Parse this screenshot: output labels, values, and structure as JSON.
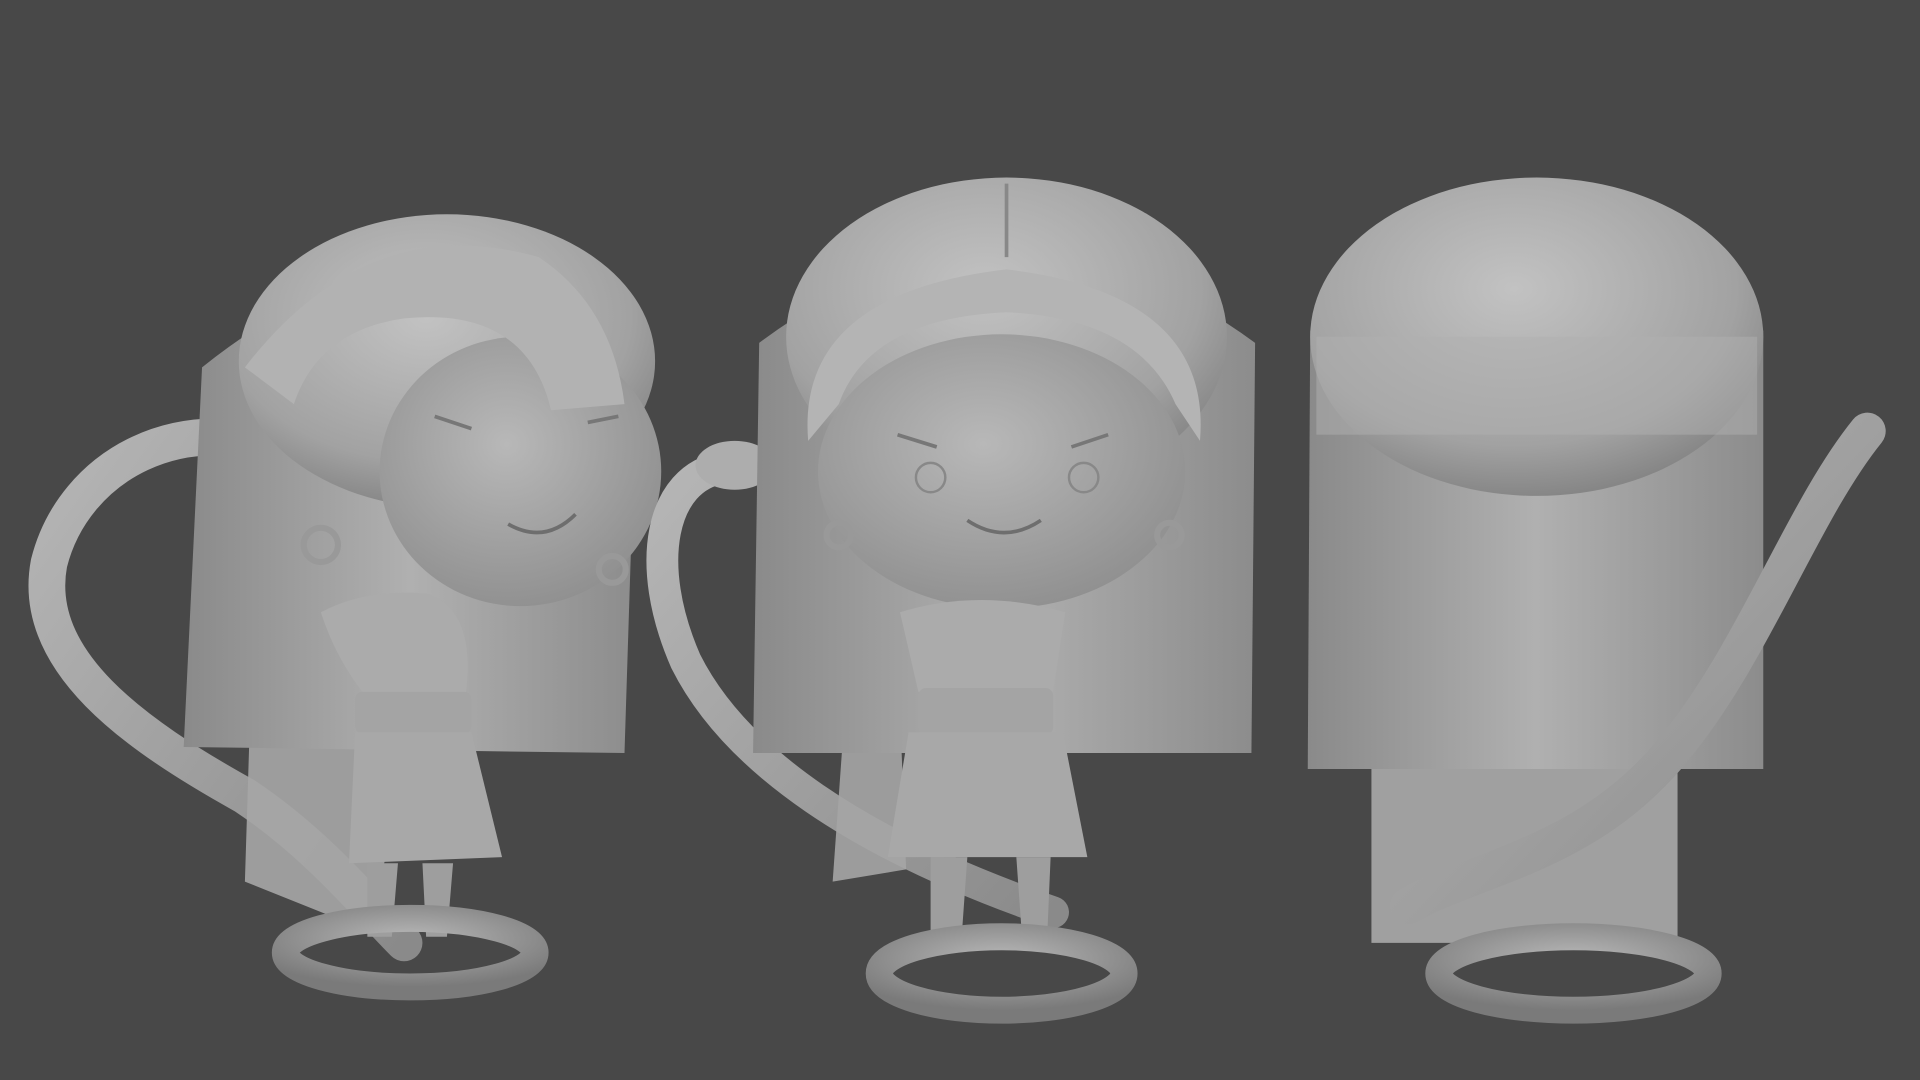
{
  "scene": {
    "background_color": "#484848",
    "model_color": "#9c9c9c",
    "highlight_color": "#c4c4c4",
    "shadow_color": "#6e6e6e",
    "views": [
      "front-three-quarter",
      "front",
      "back"
    ]
  }
}
